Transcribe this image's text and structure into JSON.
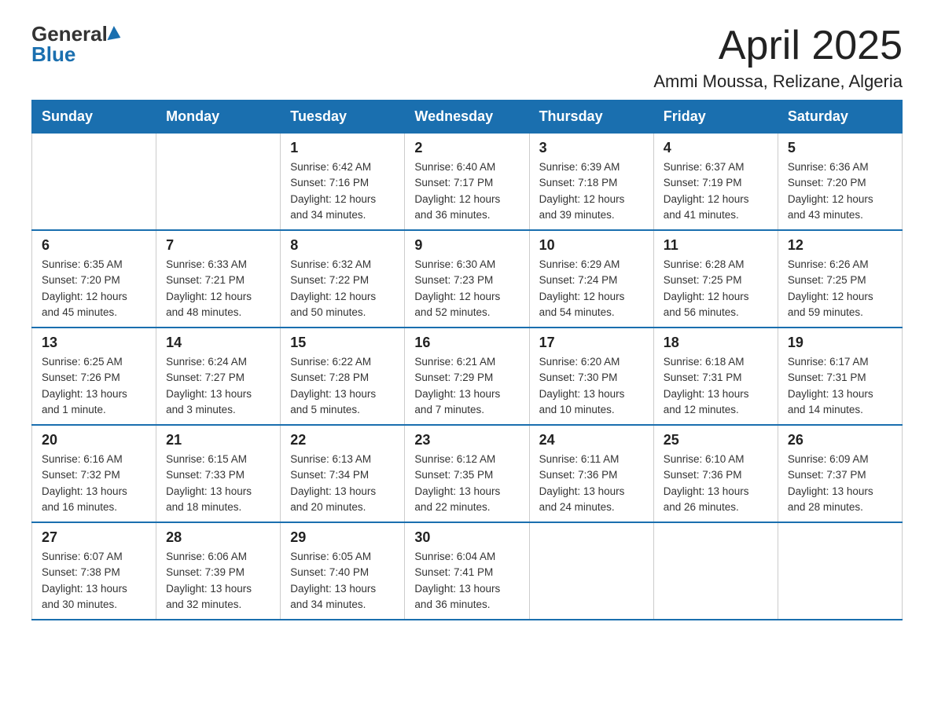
{
  "logo": {
    "line1": "General",
    "line2": "Blue"
  },
  "header": {
    "title": "April 2025",
    "subtitle": "Ammi Moussa, Relizane, Algeria"
  },
  "weekdays": [
    "Sunday",
    "Monday",
    "Tuesday",
    "Wednesday",
    "Thursday",
    "Friday",
    "Saturday"
  ],
  "weeks": [
    [
      {
        "day": "",
        "info": ""
      },
      {
        "day": "",
        "info": ""
      },
      {
        "day": "1",
        "info": "Sunrise: 6:42 AM\nSunset: 7:16 PM\nDaylight: 12 hours\nand 34 minutes."
      },
      {
        "day": "2",
        "info": "Sunrise: 6:40 AM\nSunset: 7:17 PM\nDaylight: 12 hours\nand 36 minutes."
      },
      {
        "day": "3",
        "info": "Sunrise: 6:39 AM\nSunset: 7:18 PM\nDaylight: 12 hours\nand 39 minutes."
      },
      {
        "day": "4",
        "info": "Sunrise: 6:37 AM\nSunset: 7:19 PM\nDaylight: 12 hours\nand 41 minutes."
      },
      {
        "day": "5",
        "info": "Sunrise: 6:36 AM\nSunset: 7:20 PM\nDaylight: 12 hours\nand 43 minutes."
      }
    ],
    [
      {
        "day": "6",
        "info": "Sunrise: 6:35 AM\nSunset: 7:20 PM\nDaylight: 12 hours\nand 45 minutes."
      },
      {
        "day": "7",
        "info": "Sunrise: 6:33 AM\nSunset: 7:21 PM\nDaylight: 12 hours\nand 48 minutes."
      },
      {
        "day": "8",
        "info": "Sunrise: 6:32 AM\nSunset: 7:22 PM\nDaylight: 12 hours\nand 50 minutes."
      },
      {
        "day": "9",
        "info": "Sunrise: 6:30 AM\nSunset: 7:23 PM\nDaylight: 12 hours\nand 52 minutes."
      },
      {
        "day": "10",
        "info": "Sunrise: 6:29 AM\nSunset: 7:24 PM\nDaylight: 12 hours\nand 54 minutes."
      },
      {
        "day": "11",
        "info": "Sunrise: 6:28 AM\nSunset: 7:25 PM\nDaylight: 12 hours\nand 56 minutes."
      },
      {
        "day": "12",
        "info": "Sunrise: 6:26 AM\nSunset: 7:25 PM\nDaylight: 12 hours\nand 59 minutes."
      }
    ],
    [
      {
        "day": "13",
        "info": "Sunrise: 6:25 AM\nSunset: 7:26 PM\nDaylight: 13 hours\nand 1 minute."
      },
      {
        "day": "14",
        "info": "Sunrise: 6:24 AM\nSunset: 7:27 PM\nDaylight: 13 hours\nand 3 minutes."
      },
      {
        "day": "15",
        "info": "Sunrise: 6:22 AM\nSunset: 7:28 PM\nDaylight: 13 hours\nand 5 minutes."
      },
      {
        "day": "16",
        "info": "Sunrise: 6:21 AM\nSunset: 7:29 PM\nDaylight: 13 hours\nand 7 minutes."
      },
      {
        "day": "17",
        "info": "Sunrise: 6:20 AM\nSunset: 7:30 PM\nDaylight: 13 hours\nand 10 minutes."
      },
      {
        "day": "18",
        "info": "Sunrise: 6:18 AM\nSunset: 7:31 PM\nDaylight: 13 hours\nand 12 minutes."
      },
      {
        "day": "19",
        "info": "Sunrise: 6:17 AM\nSunset: 7:31 PM\nDaylight: 13 hours\nand 14 minutes."
      }
    ],
    [
      {
        "day": "20",
        "info": "Sunrise: 6:16 AM\nSunset: 7:32 PM\nDaylight: 13 hours\nand 16 minutes."
      },
      {
        "day": "21",
        "info": "Sunrise: 6:15 AM\nSunset: 7:33 PM\nDaylight: 13 hours\nand 18 minutes."
      },
      {
        "day": "22",
        "info": "Sunrise: 6:13 AM\nSunset: 7:34 PM\nDaylight: 13 hours\nand 20 minutes."
      },
      {
        "day": "23",
        "info": "Sunrise: 6:12 AM\nSunset: 7:35 PM\nDaylight: 13 hours\nand 22 minutes."
      },
      {
        "day": "24",
        "info": "Sunrise: 6:11 AM\nSunset: 7:36 PM\nDaylight: 13 hours\nand 24 minutes."
      },
      {
        "day": "25",
        "info": "Sunrise: 6:10 AM\nSunset: 7:36 PM\nDaylight: 13 hours\nand 26 minutes."
      },
      {
        "day": "26",
        "info": "Sunrise: 6:09 AM\nSunset: 7:37 PM\nDaylight: 13 hours\nand 28 minutes."
      }
    ],
    [
      {
        "day": "27",
        "info": "Sunrise: 6:07 AM\nSunset: 7:38 PM\nDaylight: 13 hours\nand 30 minutes."
      },
      {
        "day": "28",
        "info": "Sunrise: 6:06 AM\nSunset: 7:39 PM\nDaylight: 13 hours\nand 32 minutes."
      },
      {
        "day": "29",
        "info": "Sunrise: 6:05 AM\nSunset: 7:40 PM\nDaylight: 13 hours\nand 34 minutes."
      },
      {
        "day": "30",
        "info": "Sunrise: 6:04 AM\nSunset: 7:41 PM\nDaylight: 13 hours\nand 36 minutes."
      },
      {
        "day": "",
        "info": ""
      },
      {
        "day": "",
        "info": ""
      },
      {
        "day": "",
        "info": ""
      }
    ]
  ]
}
